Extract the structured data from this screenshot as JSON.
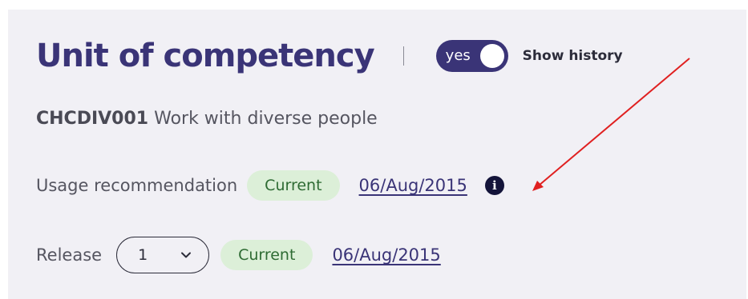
{
  "header": {
    "title": "Unit of competency",
    "toggle_label": "yes",
    "history_label": "Show history"
  },
  "unit": {
    "code": "CHCDIV001",
    "name": "Work with diverse people"
  },
  "usage": {
    "label": "Usage recommendation",
    "status": "Current",
    "date": "06/Aug/2015"
  },
  "release": {
    "label": "Release",
    "selected": "1",
    "status": "Current",
    "date": "06/Aug/2015"
  },
  "icons": {
    "info": "info-icon",
    "chevron": "chevron-down-icon",
    "arrow": "annotation-arrow"
  },
  "colors": {
    "accent": "#3a3477",
    "badge_bg": "#dcefd8",
    "badge_text": "#2e6b33",
    "arrow": "#e02020"
  }
}
